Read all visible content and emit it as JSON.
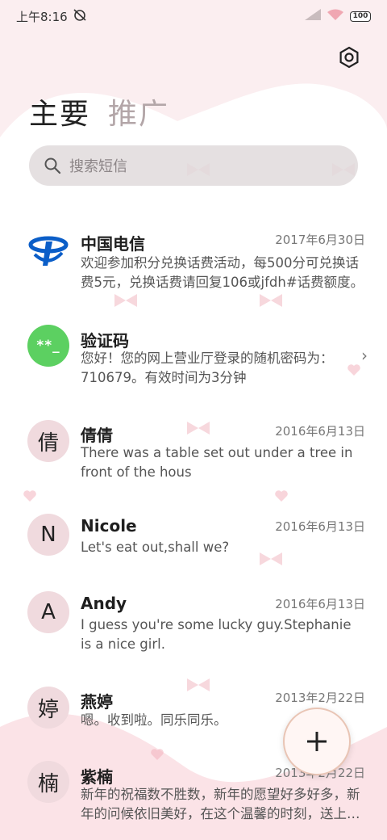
{
  "status_bar": {
    "time": "上午8:16",
    "battery": "100"
  },
  "tabs": [
    {
      "label": "主要",
      "active": true
    },
    {
      "label": "推广",
      "active": false
    }
  ],
  "search": {
    "placeholder": "搜索短信"
  },
  "messages": [
    {
      "sender": "中国电信",
      "date": "2017年6月30日",
      "preview": "欢迎参加积分兑换话费活动，每500分可兑换话费5元，兑换话费请回复106或jfdh#话费额度。",
      "avatar": "telecom-logo-icon"
    },
    {
      "sender": "验证码",
      "date": "",
      "preview": "您好！您的网上营业厅登录的随机密码为：710679。有效时间为3分钟",
      "avatar_text": "**_"
    },
    {
      "sender": "倩倩",
      "date": "2016年6月13日",
      "preview": "There was a table set out under a tree in front of the hous",
      "avatar_text": "倩"
    },
    {
      "sender": "Nicole",
      "date": "2016年6月13日",
      "preview": "Let's eat out,shall we?",
      "avatar_text": "N"
    },
    {
      "sender": "Andy",
      "date": "2016年6月13日",
      "preview": "I guess you're some lucky guy.Stephanie is a nice girl.",
      "avatar_text": "A"
    },
    {
      "sender": "燕婷",
      "date": "2013年2月22日",
      "preview": "嗯。收到啦。同乐同乐。",
      "avatar_text": "婷"
    },
    {
      "sender": "紫楠",
      "date": "2013年2月22日",
      "preview": "新年的祝福数不胜数，新年的愿望好多好多，新年的问候依旧美好，在这个温馨的时刻，送上我的祝福。",
      "avatar_text": "楠"
    }
  ],
  "fab": {
    "label": "+"
  },
  "colors": {
    "background": "#fbeef0",
    "pink": "#f3c8cf",
    "green": "#5cd061",
    "telecom_blue": "#0b5ec8"
  }
}
